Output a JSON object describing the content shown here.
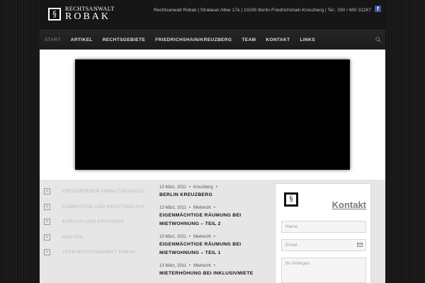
{
  "header": {
    "logo_line1": "RECHTSANWALT",
    "logo_line2": "ROBAK",
    "logo_symbol": "§",
    "contact_line": "Rechtsanwalt Robak | Stralauer Allee 17e | 10245 Berlin-Friedrichshain-Kreuzberg | Tel.: 030 / 600 31267",
    "facebook_glyph": "f"
  },
  "nav": {
    "items": [
      "START",
      "ARTIKEL",
      "RECHTSGEBIETE",
      "FRIEDRICHSHAIN/KREUZBERG",
      "TEAM",
      "KONTAKT",
      "LINKS"
    ]
  },
  "features": {
    "plus_glyph": "+",
    "items": [
      "KREUZBERGER ANWALTSKANZLEI",
      "KOMPETEND UND VERSTÄNDLICH",
      "EHRLICH UND ERFAHREN",
      "KOSTEN",
      "TEAM RECHTSANWALT ROBAK"
    ]
  },
  "articles": [
    {
      "date": "13 März, 2011",
      "category": "Kreuzberg",
      "title": "BERLIN KREUZBERG"
    },
    {
      "date": "13 März, 2011",
      "category": "Mietrecht",
      "title": "EIGENMÄCHTIGE RÄUMUNG BEI MIETWOHNUNG – TEIL 2"
    },
    {
      "date": "13 März, 2011",
      "category": "Mietrecht",
      "title": "EIGENMÄCHTIGE RÄUMUNG BEI MIETWOHNUNG – TEIL 1"
    },
    {
      "date": "13 März, 2011",
      "category": "Mietrecht",
      "title": "MIETERHÖHUNG BEI INKLUSIVMIETE"
    }
  ],
  "contact": {
    "title": "Kontakt",
    "logo_symbol": "§",
    "name_placeholder": "Name",
    "email_placeholder": "Email",
    "message_placeholder": "Ihr Anliegen"
  },
  "colors": {
    "background": "#141414",
    "nav": "#1f1f1f",
    "panel": "#e6e6e6",
    "facebook": "#3b5998"
  }
}
